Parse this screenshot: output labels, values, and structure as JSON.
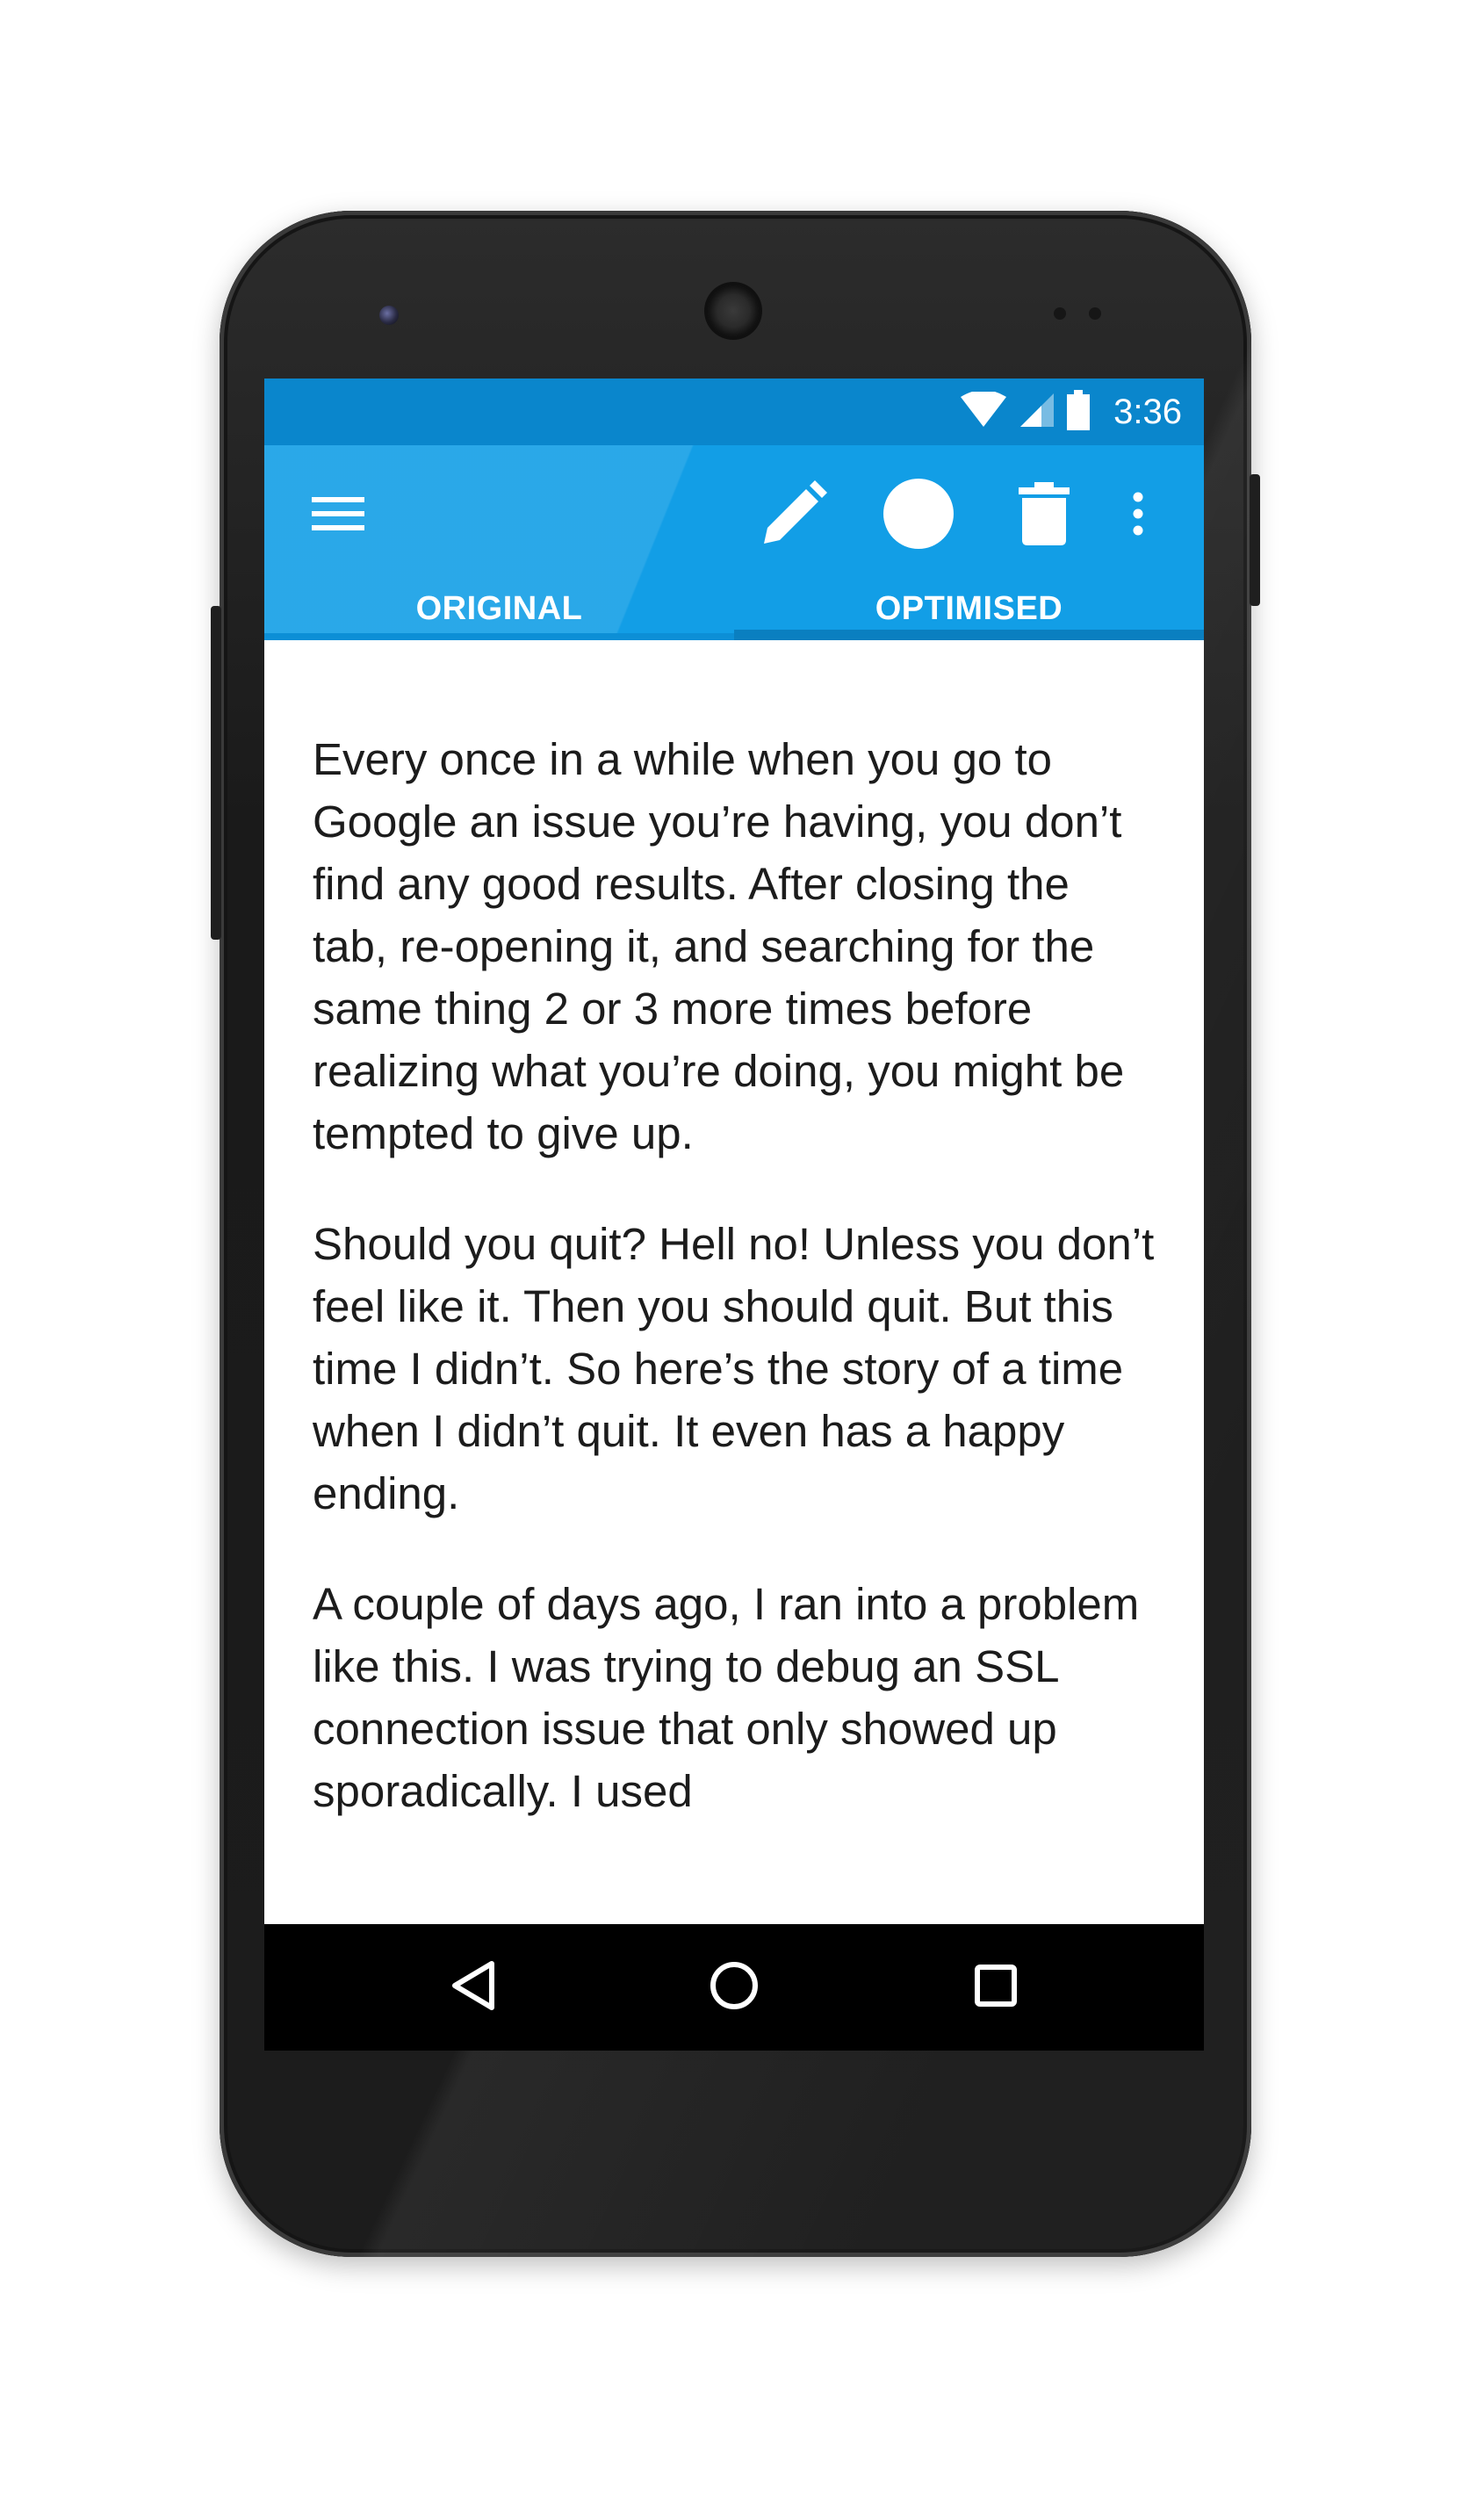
{
  "status_bar": {
    "time": "3:36",
    "icons": [
      "wifi-icon",
      "cell-signal-icon",
      "battery-icon"
    ]
  },
  "toolbar": {
    "icons": [
      "menu-icon",
      "pencil-icon",
      "circle-icon",
      "trash-icon",
      "overflow-icon"
    ]
  },
  "tabs": [
    {
      "label": "ORIGINAL",
      "selected": false
    },
    {
      "label": "OPTIMISED",
      "selected": true
    }
  ],
  "article": {
    "paragraphs": [
      "Every once in a while when you go to Google an issue you’re having, you don’t find any good results. After closing the tab, re-opening it, and searching for the same thing 2 or 3 more times before realizing what you’re doing, you might be tempted to give up.",
      "Should you quit? Hell no! Unless you don’t feel like it. Then you should quit. But this time I didn’t. So here’s the story of a time when I didn’t quit. It even has a happy ending.",
      "A couple of days ago, I ran into a problem like this. I was trying to debug an SSL connection issue that only showed up sporadically. I used"
    ]
  },
  "nav_bar": {
    "icons": [
      "back-icon",
      "home-icon",
      "recents-icon"
    ]
  },
  "colors": {
    "status_bar": "#0a86cc",
    "app_bar": "#129ee6",
    "tab_indicator": "#0a7fc0",
    "text": "#1c1c1c"
  }
}
